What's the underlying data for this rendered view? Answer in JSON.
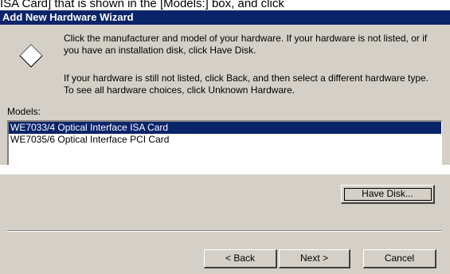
{
  "top_caption": "ISA Card] that is shown in the [Models:] box, and click",
  "window": {
    "title": "Add New Hardware Wizard"
  },
  "icon": {
    "name": "diamond-icon"
  },
  "instructions": {
    "paragraph1": "Click the manufacturer and model of your hardware. If your hardware is not listed, or if you have an installation disk, click Have Disk.",
    "paragraph2": "If your hardware is still not listed, click Back, and then select a different hardware type. To see all hardware choices, click Unknown Hardware."
  },
  "models": {
    "label": "Models:",
    "items": [
      {
        "label": "WE7033/4 Optical Interface ISA Card",
        "selected": true
      },
      {
        "label": "WE7035/6 Optical Interface PCI Card",
        "selected": false
      }
    ]
  },
  "buttons": {
    "have_disk": "Have Disk...",
    "back": "< Back",
    "next": "Next >",
    "cancel": "Cancel"
  },
  "colors": {
    "titlebar": "#0a246a",
    "dialog_face": "#d4d0c8",
    "selection": "#0a246a"
  }
}
